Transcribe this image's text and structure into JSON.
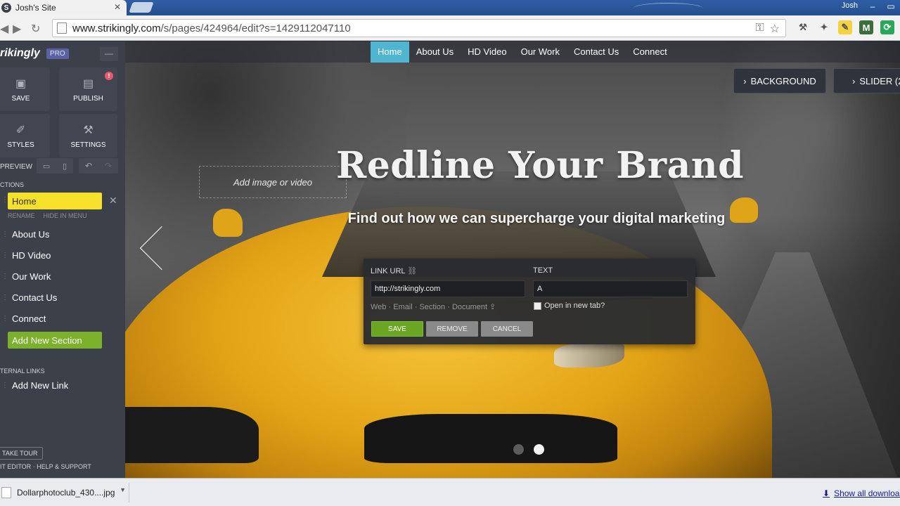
{
  "browser": {
    "tab_title": "Josh's Site",
    "tab_favicon": "S",
    "tab_close": "✕",
    "user": "Josh",
    "url_host": "www.strikingly.com",
    "url_path": "/s/pages/424964/edit?s=1429112047110"
  },
  "sidebar": {
    "brand": "rikingly",
    "pro": "PRO",
    "tools": {
      "save": "SAVE",
      "publish": "PUBLISH",
      "publish_badge": "!",
      "styles": "STYLES",
      "settings": "SETTINGS"
    },
    "preview": "PREVIEW",
    "sections_label": "CTIONS",
    "home": "Home",
    "rename": "RENAME",
    "hide_in_menu": "HIDE IN MENU",
    "sections": [
      "About Us",
      "HD Video",
      "Our Work",
      "Contact Us",
      "Connect"
    ],
    "add_section": "Add New Section",
    "external_label": "TERNAL LINKS",
    "add_link": "Add New Link",
    "take_tour": "TAKE TOUR",
    "exit_help": "IT EDITOR · HELP & SUPPORT"
  },
  "site": {
    "nav": [
      "Home",
      "About Us",
      "HD Video",
      "Our Work",
      "Contact Us",
      "Connect"
    ],
    "active_nav": "Home",
    "background_btn": "BACKGROUND",
    "slider_btn": "SLIDER (2",
    "title": "Redline Your Brand",
    "subtitle": "Find out how we can supercharge your digital marketing",
    "add_media": "Add image or video",
    "slide_count": 2,
    "active_slide": 2
  },
  "link_dialog": {
    "url_label": "LINK URL",
    "url_value": "http://strikingly.com",
    "text_label": "TEXT",
    "text_value": "A",
    "types": "Web · Email · Section · Document",
    "open_new_tab": "Open in new tab?",
    "open_new_tab_checked": false,
    "save": "SAVE",
    "remove": "REMOVE",
    "cancel": "CANCEL"
  },
  "downloads": {
    "file": "Dollarphotoclub_430....jpg",
    "show_all": "Show all downloads"
  },
  "colors": {
    "nav_active": "#50b5d1",
    "home_highlight": "#f7e02a",
    "add_section": "#7bb12b",
    "save_button": "#6aa624"
  }
}
